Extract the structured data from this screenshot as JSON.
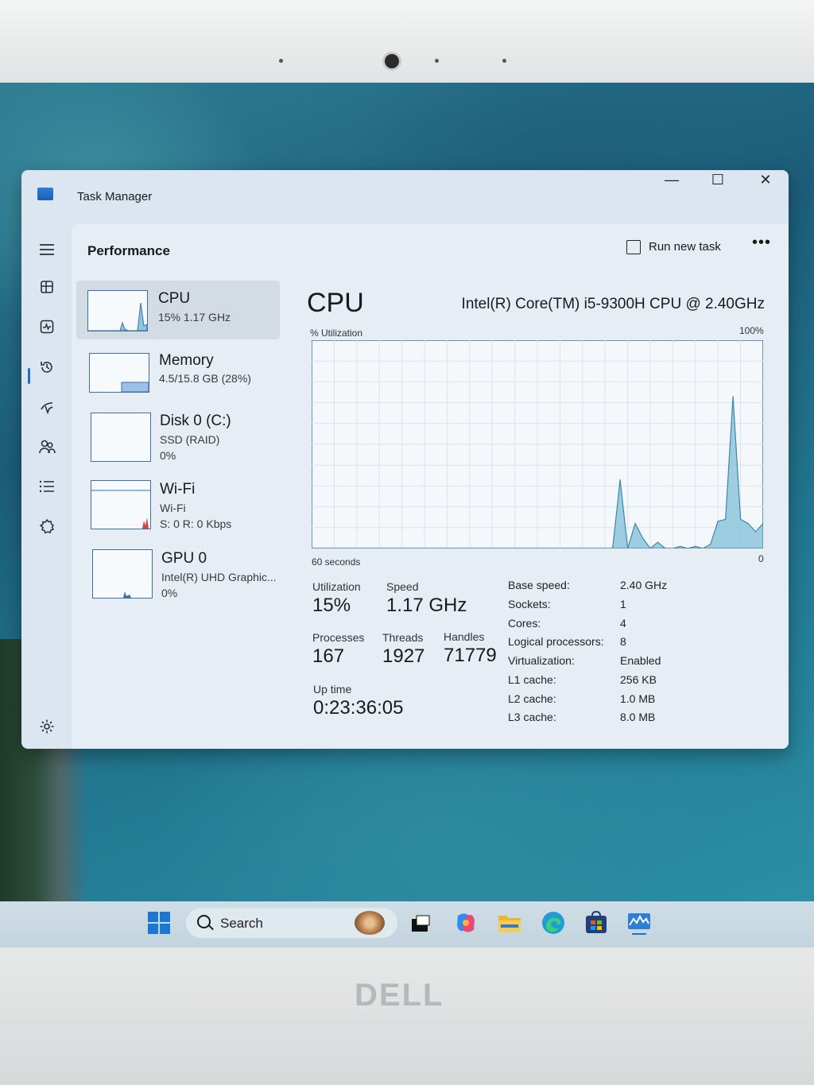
{
  "window": {
    "title": "Task Manager",
    "minimize": "—",
    "maximize": "☐",
    "close": "✕"
  },
  "nav_icons": [
    "hamburger-icon",
    "processes-icon",
    "performance-icon",
    "app-history-icon",
    "startup-apps-icon",
    "users-icon",
    "details-icon",
    "services-icon",
    "settings-icon"
  ],
  "page": {
    "title": "Performance",
    "run_new_task": "Run new task",
    "more": "•••"
  },
  "devices": [
    {
      "name": "CPU",
      "line1": "15%  1.17 GHz",
      "line2": ""
    },
    {
      "name": "Memory",
      "line1": "4.5/15.8 GB (28%)",
      "line2": ""
    },
    {
      "name": "Disk 0 (C:)",
      "line1": "SSD (RAID)",
      "line2": "0%"
    },
    {
      "name": "Wi-Fi",
      "line1": "Wi-Fi",
      "line2": "S: 0 R: 0 Kbps"
    },
    {
      "name": "GPU 0",
      "line1": "Intel(R) UHD Graphic...",
      "line2": "0%"
    }
  ],
  "cpu": {
    "heading": "CPU",
    "model": "Intel(R) Core(TM) i5-9300H CPU @ 2.40GHz",
    "util_label": "% Utilization",
    "max_label": "100%",
    "time_label": "60 seconds",
    "min_label": "0",
    "stats": {
      "utilization_label": "Utilization",
      "utilization": "15%",
      "speed_label": "Speed",
      "speed": "1.17 GHz",
      "processes_label": "Processes",
      "processes": "167",
      "threads_label": "Threads",
      "threads": "1927",
      "handles_label": "Handles",
      "handles": "71779",
      "uptime_label": "Up time",
      "uptime": "0:23:36:05"
    },
    "specs": [
      {
        "key": "Base speed:",
        "value": "2.40 GHz"
      },
      {
        "key": "Sockets:",
        "value": "1"
      },
      {
        "key": "Cores:",
        "value": "4"
      },
      {
        "key": "Logical processors:",
        "value": "8"
      },
      {
        "key": "Virtualization:",
        "value": "Enabled"
      },
      {
        "key": "L1 cache:",
        "value": "256 KB"
      },
      {
        "key": "L2 cache:",
        "value": "1.0 MB"
      },
      {
        "key": "L3 cache:",
        "value": "8.0 MB"
      }
    ]
  },
  "chart_data": {
    "type": "area",
    "title": "",
    "xlabel": "60 seconds",
    "ylabel": "% Utilization",
    "xlim": [
      60,
      0
    ],
    "ylim": [
      0,
      100
    ],
    "x": [
      60,
      57,
      54,
      51,
      48,
      45,
      42,
      39,
      36,
      33,
      30,
      27,
      24,
      21,
      20,
      19,
      18,
      17,
      16,
      15,
      14,
      13,
      12,
      11,
      10,
      9,
      8,
      7,
      6,
      5,
      4,
      3,
      2,
      1,
      0
    ],
    "series": [
      {
        "values": [
          0,
          0,
          0,
          0,
          0,
          0,
          0,
          0,
          0,
          0,
          0,
          0,
          0,
          0,
          0,
          33,
          0,
          12,
          5,
          0,
          3,
          0,
          0,
          1,
          0,
          1,
          0,
          2,
          13,
          14,
          73,
          14,
          12,
          8,
          12
        ]
      }
    ],
    "grid": true,
    "color": "#8cc5dc"
  },
  "taskbar": {
    "search": "Search",
    "apps": [
      "start-icon",
      "widget-icon",
      "task-view-icon",
      "copilot-icon",
      "file-explorer-icon",
      "edge-icon",
      "store-icon",
      "task-manager-icon"
    ]
  },
  "brand": "DELL"
}
